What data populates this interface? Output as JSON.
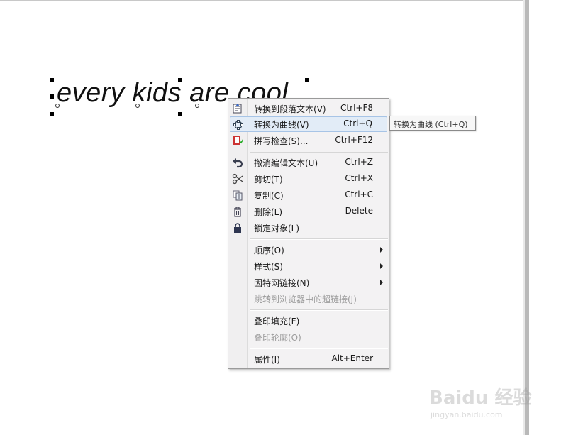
{
  "canvas": {
    "text": "every kids are cool"
  },
  "context_menu": {
    "items": [
      {
        "label": "转换到段落文本(V)",
        "shortcut": "Ctrl+F8",
        "icon": "paragraph-text-icon"
      },
      {
        "label": "转换为曲线(V)",
        "shortcut": "Ctrl+Q",
        "icon": "curve-icon",
        "highlighted": true
      },
      {
        "label": "拼写检查(S)...",
        "shortcut": "Ctrl+F12",
        "icon": "spell-check-icon"
      },
      {
        "label": "撤消编辑文本(U)",
        "shortcut": "Ctrl+Z",
        "icon": "undo-icon"
      },
      {
        "label": "剪切(T)",
        "shortcut": "Ctrl+X",
        "icon": "scissors-icon"
      },
      {
        "label": "复制(C)",
        "shortcut": "Ctrl+C",
        "icon": "copy-icon"
      },
      {
        "label": "删除(L)",
        "shortcut": "Delete",
        "icon": "trash-icon"
      },
      {
        "label": "锁定对象(L)",
        "shortcut": "",
        "icon": "lock-icon"
      },
      {
        "label": "顺序(O)",
        "submenu": true
      },
      {
        "label": "样式(S)",
        "submenu": true
      },
      {
        "label": "因特网链接(N)",
        "submenu": true
      },
      {
        "label": "跳转到浏览器中的超链接(J)",
        "disabled": true
      },
      {
        "label": "叠印填充(F)"
      },
      {
        "label": "叠印轮廓(O)",
        "disabled": true
      },
      {
        "label": "属性(I)",
        "shortcut": "Alt+Enter"
      }
    ]
  },
  "tooltip": {
    "text": "转换为曲线 (Ctrl+Q)"
  },
  "watermark": {
    "brand": "Baidu 经验",
    "url": "jingyan.baidu.com"
  },
  "colors": {
    "menu_bg": "#f3f2f3",
    "highlight_bg": "#e2ecf7",
    "highlight_border": "#a7c4e6",
    "disabled_text": "#9c9c9c"
  }
}
